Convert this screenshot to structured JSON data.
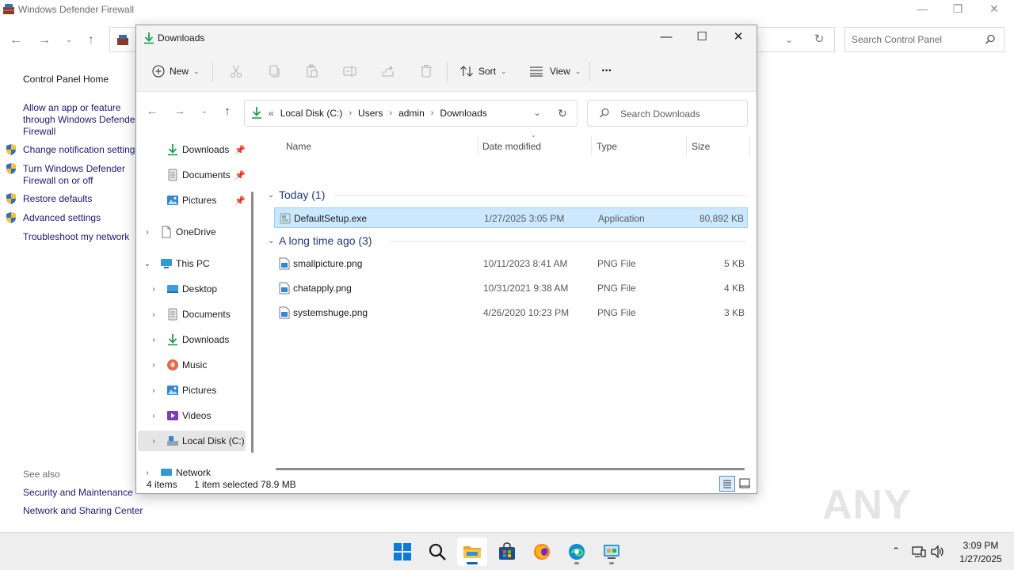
{
  "control_panel": {
    "title": "Windows Defender Firewall",
    "caption": {
      "minimize": "—",
      "maximize": "❐",
      "close": "✕"
    },
    "search_placeholder": "Search Control Panel",
    "left_links": {
      "home": "Control Panel Home",
      "allow_line1": "Allow an app or feature",
      "allow_line2": "through Windows Defender",
      "allow_line3": "Firewall",
      "change_notif": "Change notification settings",
      "turn_line1": "Turn Windows Defender",
      "turn_line2": "Firewall on or off",
      "restore": "Restore defaults",
      "advanced": "Advanced settings",
      "troubleshoot": "Troubleshoot my network"
    },
    "see_also": {
      "heading": "See also",
      "security": "Security and Maintenance",
      "network": "Network and Sharing Center"
    }
  },
  "explorer": {
    "title": "Downloads",
    "toolbar": {
      "new": "New",
      "sort": "Sort",
      "view": "View",
      "more": "···"
    },
    "breadcrumb": {
      "overflow": "«",
      "items": [
        "Local Disk (C:)",
        "Users",
        "admin",
        "Downloads"
      ]
    },
    "search_placeholder": "Search Downloads",
    "nav_pane": {
      "quick": [
        {
          "label": "Downloads"
        },
        {
          "label": "Documents"
        },
        {
          "label": "Pictures"
        }
      ],
      "onedrive": "OneDrive",
      "this_pc": "This PC",
      "pc_items": [
        "Desktop",
        "Documents",
        "Downloads",
        "Music",
        "Pictures",
        "Videos",
        "Local Disk (C:)"
      ],
      "network": "Network"
    },
    "columns": {
      "name": "Name",
      "date": "Date modified",
      "type": "Type",
      "size": "Size"
    },
    "groups": [
      {
        "label": "Today (1)",
        "files": [
          {
            "name": "DefaultSetup.exe",
            "date": "1/27/2025 3:05 PM",
            "type": "Application",
            "size": "80,892 KB",
            "selected": true
          }
        ]
      },
      {
        "label": "A long time ago (3)",
        "files": [
          {
            "name": "smallpicture.png",
            "date": "10/11/2023 8:41 AM",
            "type": "PNG File",
            "size": "5 KB"
          },
          {
            "name": "chatapply.png",
            "date": "10/31/2021 9:38 AM",
            "type": "PNG File",
            "size": "4 KB"
          },
          {
            "name": "systemshuge.png",
            "date": "4/26/2020 10:23 PM",
            "type": "PNG File",
            "size": "3 KB"
          }
        ]
      }
    ],
    "status": {
      "count": "4 items",
      "selected": "1 item selected",
      "size": "78.9 MB"
    }
  },
  "watermark": "ANY RUN",
  "taskbar": {
    "clock_time": "3:09 PM",
    "clock_date": "1/27/2025"
  },
  "colors": {
    "accent": "#0067c0",
    "selection": "#cce8ff",
    "download_green": "#1e9e4a"
  }
}
